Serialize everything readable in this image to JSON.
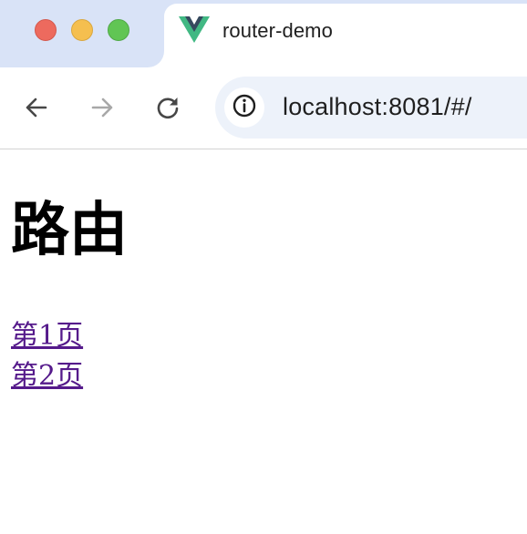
{
  "browser": {
    "tab": {
      "title": "router-demo",
      "favicon": "vue-logo-icon"
    },
    "toolbar": {
      "back_icon": "arrow-left-icon",
      "forward_icon": "arrow-right-icon",
      "reload_icon": "reload-icon",
      "site_info_icon": "info-circle-icon",
      "url": "localhost:8081/#/"
    },
    "window_controls": [
      "close",
      "minimize",
      "maximize"
    ],
    "colors": {
      "tabstrip_bg": "#d9e3f7",
      "omnibox_bg": "#edf2fa",
      "close": "#ed6a5e",
      "minimize": "#f5bf4f",
      "maximize": "#61c554",
      "visited_link": "#551a8b"
    }
  },
  "page": {
    "title": "路由",
    "links": [
      {
        "label": "第1页"
      },
      {
        "label": "第2页"
      }
    ]
  }
}
